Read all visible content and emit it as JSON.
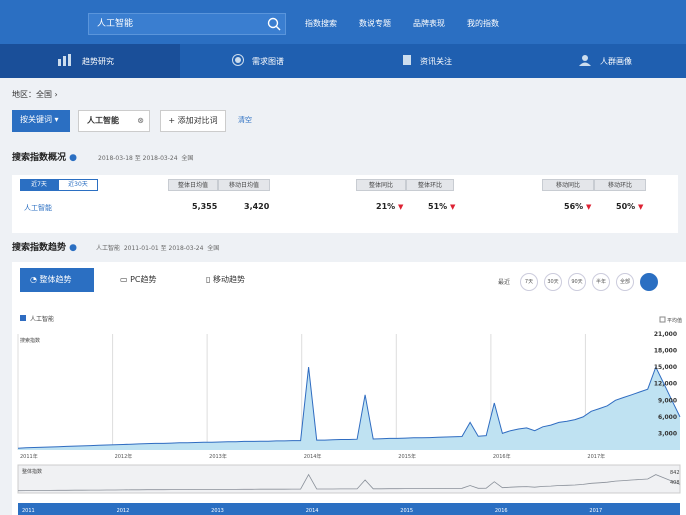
{
  "search": {
    "value": "人工智能"
  },
  "toplinks": [
    "指数搜索",
    "数说专题",
    "品牌表现",
    "我的指数"
  ],
  "nav": [
    "趋势研究",
    "需求图谱",
    "资讯关注",
    "人群画像"
  ],
  "region": "地区：全国",
  "controls": {
    "dropdown": "按关键词",
    "keyword": "人工智能",
    "add_compare": "+ 添加对比词",
    "clear": "清空"
  },
  "overview": {
    "title": "搜索指数概况",
    "date_range": "2018-03-18 至 2018-03-24",
    "scope": "全国",
    "period_tabs": [
      "近7天",
      "近30天"
    ],
    "groups": [
      {
        "headers": [
          "整体日均值",
          "移动日均值"
        ]
      },
      {
        "headers": [
          "整体同比",
          "整体环比"
        ]
      },
      {
        "headers": [
          "移动同比",
          "移动环比"
        ]
      }
    ],
    "row": {
      "keyword": "人工智能",
      "overall_avg": "5,355",
      "mobile_avg": "3,420",
      "overall_yoy": "21%",
      "overall_mom": "51%",
      "mobile_yoy": "56%",
      "mobile_mom": "50%"
    }
  },
  "trend": {
    "title": "搜索指数趋势",
    "keyword": "人工智能",
    "date_range": "2011-01-01 至 2018-03-24",
    "scope": "全国",
    "tabs": [
      "整体趋势",
      "PC趋势",
      "移动趋势"
    ],
    "range_label": "最近",
    "ranges": [
      "7天",
      "30天",
      "90天",
      "半年",
      "全部"
    ]
  },
  "chart_data": {
    "type": "area",
    "title": "",
    "ylabel": "搜索指数",
    "legend": [
      "人工智能"
    ],
    "average_label": "平均值",
    "x_ticks": [
      "2011年",
      "2012年",
      "2013年",
      "2014年",
      "2015年",
      "2016年",
      "2017年"
    ],
    "y_ticks": [
      "3,000",
      "6,000",
      "9,000",
      "12,000",
      "15,000",
      "18,000",
      "21,000"
    ],
    "ylim": [
      0,
      21000
    ],
    "series": [
      {
        "name": "人工智能",
        "values": [
          300,
          400,
          450,
          500,
          550,
          600,
          650,
          700,
          750,
          800,
          850,
          900,
          950,
          1000,
          1050,
          1100,
          1150,
          1200,
          1200,
          1250,
          1300,
          1300,
          1350,
          1400,
          1400,
          1450,
          1500,
          1500,
          1550,
          1550,
          1600,
          1600,
          1650,
          1650,
          1700,
          1700,
          15000,
          1800,
          1800,
          1850,
          1900,
          1900,
          1950,
          10000,
          2000,
          2050,
          2100,
          2100,
          2150,
          2200,
          2200,
          2250,
          2300,
          2350,
          2400,
          2450,
          5000,
          2500,
          2600,
          8500,
          3000,
          3500,
          3800,
          4000,
          3500,
          4200,
          4500,
          5000,
          5200,
          5500,
          6000,
          7000,
          7500,
          8000,
          9000,
          9500,
          10000,
          10500,
          11000,
          15000,
          12000,
          9000,
          6000
        ]
      }
    ],
    "navigator_label": "整体指数",
    "navigator_ticks": [
      "2011",
      "2012",
      "2013",
      "2014",
      "2015",
      "2016",
      "2017"
    ],
    "navigator_values": [
      "842",
      "408"
    ]
  },
  "colors": {
    "topbar": "#2b6fc2",
    "nav": "#1f5fb0",
    "line": "#2f6cc1",
    "area": "#bfe2f2"
  }
}
